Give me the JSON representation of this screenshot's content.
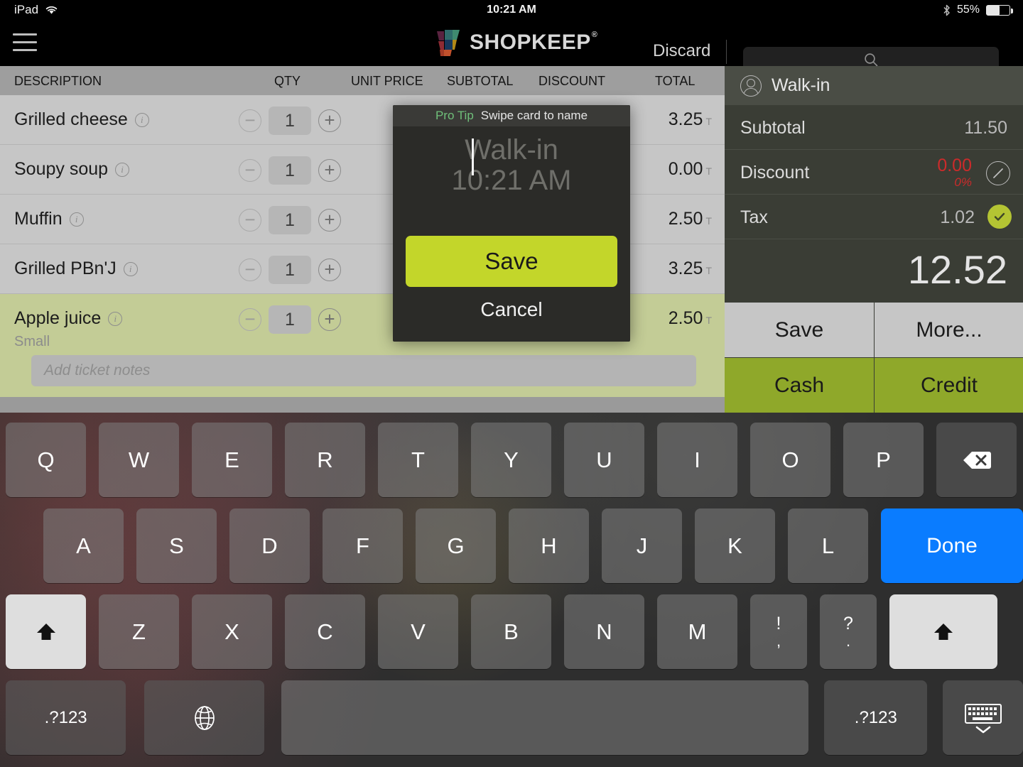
{
  "status_bar": {
    "device": "iPad",
    "wifi_icon": "wifi-icon",
    "time": "10:21 AM",
    "bluetooth_icon": "bluetooth-icon",
    "battery_percent": "55%",
    "battery_level": 55
  },
  "nav": {
    "menu_icon": "hamburger-menu-icon",
    "brand": "SHOPKEEP",
    "brand_trademark": "®",
    "discard_label": "Discard",
    "search_icon": "search-icon",
    "search_value": "",
    "search_placeholder": ""
  },
  "ticket": {
    "columns": {
      "description": "DESCRIPTION",
      "qty": "QTY",
      "unit_price": "UNIT PRICE",
      "subtotal": "SUBTOTAL",
      "discount": "DISCOUNT",
      "total": "TOTAL"
    },
    "items": [
      {
        "name": "Grilled cheese",
        "qty": "1",
        "total": "3.25",
        "tax_flag": "T",
        "modifier": "",
        "selected": false
      },
      {
        "name": "Soupy soup",
        "qty": "1",
        "total": "0.00",
        "tax_flag": "T",
        "modifier": "",
        "selected": false
      },
      {
        "name": "Muffin",
        "qty": "1",
        "total": "2.50",
        "tax_flag": "T",
        "modifier": "",
        "selected": false
      },
      {
        "name": "Grilled PBn'J",
        "qty": "1",
        "total": "3.25",
        "tax_flag": "T",
        "modifier": "",
        "selected": false
      },
      {
        "name": "Apple juice",
        "qty": "1",
        "total": "2.50",
        "tax_flag": "T",
        "modifier": "Small",
        "selected": true
      }
    ],
    "notes_placeholder": "Add ticket notes",
    "notes_value": "",
    "minus_icon": "minus-circle-icon",
    "plus_icon": "plus-circle-icon",
    "info_icon": "info-icon"
  },
  "summary": {
    "customer_icon": "person-icon",
    "customer_name": "Walk-in",
    "subtotal_label": "Subtotal",
    "subtotal_value": "11.50",
    "discount_label": "Discount",
    "discount_value": "0.00",
    "discount_percent": "0%",
    "discount_edit_icon": "pencil-circle-icon",
    "tax_label": "Tax",
    "tax_value": "1.02",
    "tax_check_icon": "check-circle-icon",
    "grand_total": "12.52",
    "buttons": {
      "save": "Save",
      "more": "More...",
      "cash": "Cash",
      "credit": "Credit"
    },
    "colors": {
      "discount_red": "#cc2b2b",
      "green_accent": "#8fa82a",
      "check_green": "#b4c433"
    }
  },
  "modal": {
    "tip_label": "Pro Tip",
    "tip_text": "Swipe card to name",
    "input_value": "",
    "placeholder_line1": "Walk-in",
    "placeholder_line2": "10:21 AM",
    "save_label": "Save",
    "cancel_label": "Cancel",
    "save_color": "#c3d62a"
  },
  "keyboard": {
    "row1": [
      "Q",
      "W",
      "E",
      "R",
      "T",
      "Y",
      "U",
      "I",
      "O",
      "P"
    ],
    "delete_icon": "delete-key-icon",
    "row2": [
      "A",
      "S",
      "D",
      "F",
      "G",
      "H",
      "J",
      "K",
      "L"
    ],
    "done_label": "Done",
    "done_color": "#0a7cff",
    "row3": [
      "Z",
      "X",
      "C",
      "V",
      "B",
      "N",
      "M"
    ],
    "punct1_top": "!",
    "punct1_bottom": ",",
    "punct2_top": "?",
    "punct2_bottom": ".",
    "shift_icon": "shift-key-icon",
    "numeric_label": ".?123",
    "globe_icon": "globe-key-icon",
    "space_label": "",
    "hide_keyboard_icon": "hide-keyboard-icon"
  }
}
